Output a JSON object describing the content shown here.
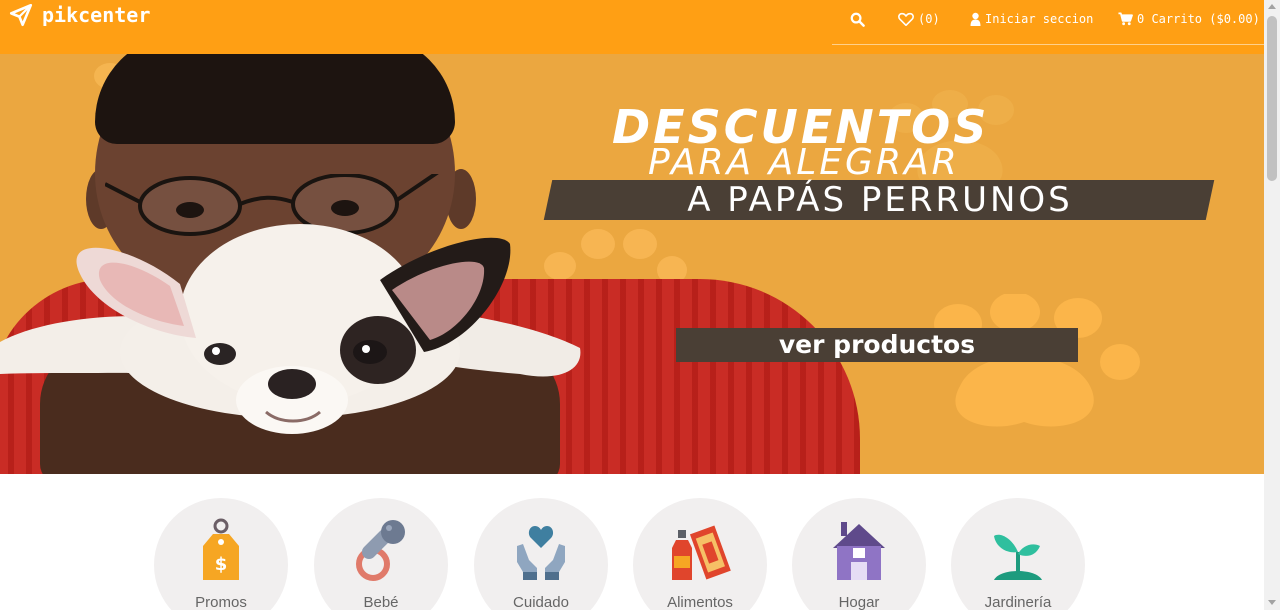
{
  "brand": {
    "name": "pikcenter",
    "icon": "paper-plane-icon"
  },
  "nav": {
    "search_icon": "search-icon",
    "wishlist_icon": "heart-icon",
    "wishlist_count": "(0)",
    "login_icon": "user-icon",
    "login_label": "Iniciar seccion",
    "cart_icon": "cart-icon",
    "cart_label": "0 Carrito ($0.00)"
  },
  "hero": {
    "headline_1": "DESCUENTOS",
    "headline_2": "PARA ALEGRAR",
    "headline_3": "A PAPÁS PERRUNOS",
    "cta_label": "ver productos"
  },
  "categories": [
    {
      "label": "Promos",
      "icon": "price-tag-icon"
    },
    {
      "label": "Bebé",
      "icon": "pacifier-icon"
    },
    {
      "label": "Cuidado",
      "icon": "heart-hands-icon"
    },
    {
      "label": "Alimentos",
      "icon": "food-icon"
    },
    {
      "label": "Hogar",
      "icon": "house-icon"
    },
    {
      "label": "Jardinería",
      "icon": "sprout-icon"
    }
  ],
  "colors": {
    "nav_bg": "#ff9f14",
    "hero_bg": "#eba740",
    "banner_dark": "#4a3f35",
    "category_bg": "#f1efef"
  }
}
